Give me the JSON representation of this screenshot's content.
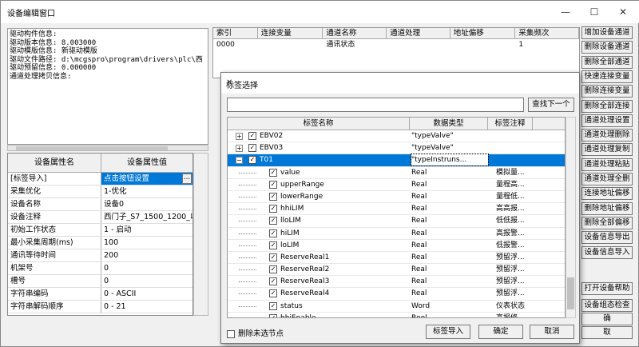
{
  "window": {
    "title": "设备编辑窗口",
    "minimize": "—",
    "maximize": "☐",
    "close": "✕"
  },
  "driver_info": [
    "驱动构件信息:",
    "驱动版本信息: 8.003000",
    "驱动模版信息: 新驱动模版",
    "驱动文件路径: d:\\mcgspro\\program\\drivers\\plc\\西",
    "驱动预留信息: 0.000000",
    "通道处理拷贝信息:"
  ],
  "properties": {
    "headers": [
      "设备属性名",
      "设备属性值"
    ],
    "rows": [
      {
        "k": "[标签导入]",
        "v": "点击按钮设置"
      },
      {
        "k": "采集优化",
        "v": "1-优化"
      },
      {
        "k": "设备名称",
        "v": "设备0"
      },
      {
        "k": "设备注释",
        "v": "西门子_S7_1500_1200_以太"
      },
      {
        "k": "初始工作状态",
        "v": "1 - 启动"
      },
      {
        "k": "最小采集周期(ms)",
        "v": "100"
      },
      {
        "k": "通讯等待时间",
        "v": "200"
      },
      {
        "k": "机架号",
        "v": "0"
      },
      {
        "k": "槽号",
        "v": "0"
      },
      {
        "k": "字符串编码",
        "v": "0 - ASCII"
      },
      {
        "k": "字符串解码顺序",
        "v": "0 - 21"
      }
    ],
    "ellipsis": "..."
  },
  "channels": {
    "headers": [
      "索引",
      "连接变量",
      "通道名称",
      "通道处理",
      "地址偏移",
      "采集频次"
    ],
    "rows": [
      {
        "idx": "0000",
        "var": "",
        "name": "通讯状态",
        "proc": "",
        "off": "",
        "freq": "1"
      }
    ]
  },
  "right_buttons": [
    "增加设备通道",
    "删除设备通道",
    "删除全部通道",
    "快速连接变量",
    "删除连接变量",
    "删除全部连接",
    "通道处理设置",
    "通道处理删除",
    "通道处理复制",
    "通道处理粘贴",
    "通道处理全删",
    "连接地址偏移",
    "删除地址偏移",
    "删除全部偏移",
    "设备信息导出",
    "设备信息导入",
    "打开设备帮助",
    "设备组态检查",
    "确",
    "取"
  ],
  "dialog": {
    "title": "标签选择",
    "close": "✕",
    "search_value": "",
    "find_next": "查找下一个",
    "headers": [
      "标签名称",
      "数据类型",
      "标签注释"
    ],
    "rows": [
      {
        "name": "EBV02",
        "type": "\"typeValve\"",
        "note": "",
        "level": 0,
        "exp": "+"
      },
      {
        "name": "EBV03",
        "type": "\"typeValve\"",
        "note": "",
        "level": 0,
        "exp": "+"
      },
      {
        "name": "T01",
        "type": "\"typeInstruns...",
        "note": "",
        "level": 0,
        "exp": "−",
        "sel": true
      },
      {
        "name": "value",
        "type": "Real",
        "note": "模拟量...",
        "level": 1
      },
      {
        "name": "upperRange",
        "type": "Real",
        "note": "量程高...",
        "level": 1
      },
      {
        "name": "lowerRange",
        "type": "Real",
        "note": "量程低...",
        "level": 1
      },
      {
        "name": "hhiLIM",
        "type": "Real",
        "note": "高高报...",
        "level": 1
      },
      {
        "name": "lloLIM",
        "type": "Real",
        "note": "低低报...",
        "level": 1
      },
      {
        "name": "hiLIM",
        "type": "Real",
        "note": "高报警...",
        "level": 1
      },
      {
        "name": "loLIM",
        "type": "Real",
        "note": "低报警...",
        "level": 1
      },
      {
        "name": "ReserveReal1",
        "type": "Real",
        "note": "预留浮...",
        "level": 1
      },
      {
        "name": "ReserveReal2",
        "type": "Real",
        "note": "预留浮...",
        "level": 1
      },
      {
        "name": "ReserveReal3",
        "type": "Real",
        "note": "预留浮...",
        "level": 1
      },
      {
        "name": "ReserveReal4",
        "type": "Real",
        "note": "预留浮...",
        "level": 1
      },
      {
        "name": "status",
        "type": "Word",
        "note": "仪表状态",
        "level": 1
      },
      {
        "name": "hhiEnable",
        "type": "Bool",
        "note": "高报修...",
        "level": 1
      }
    ],
    "delete_unselected": "删除未选节点",
    "import_btn": "标签导入",
    "ok_btn": "确定",
    "cancel_btn": "取消"
  }
}
